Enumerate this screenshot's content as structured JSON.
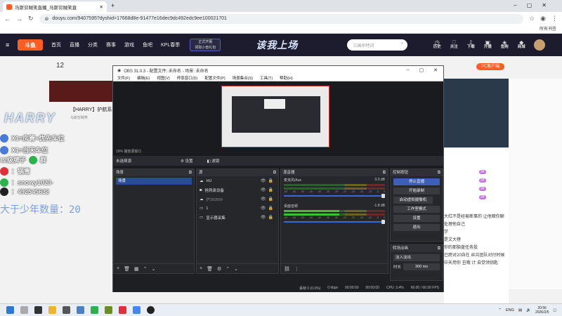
{
  "browser": {
    "tab_title": "马斯穷贼笑直播_马斯穷贼笑直",
    "url": "douyu.com/9407595?dyshid=17668d8e-91477e16dec9dc492edc9ee100021701",
    "bookmarks_label": "所有书签"
  },
  "douyu": {
    "logo": "斗鱼",
    "nav": [
      "首页",
      "直播",
      "分类",
      "赛事",
      "游戏",
      "鱼吧",
      "KPL春季"
    ],
    "promo_line1": "正式开服",
    "promo_line2": "领取小兽礼包",
    "banner": "该我上场",
    "search_placeholder": "三国杀特训",
    "header_icons": [
      "历史",
      "关注",
      "下载",
      "开播",
      "鱼购",
      "商城"
    ],
    "day_num": "12",
    "pc_badge": "PC客户端",
    "streamer_name": "【HARRY】护航系",
    "streamer_sub": "马斯穷贼笑"
  },
  "overlay": {
    "harry": "HARRY",
    "lines": [
      "X1=房管+优先车位",
      "X1=当天车位",
      "12级牌子",
      "：锅雪",
      "：snowy1023-",
      "：492545632"
    ],
    "group_word": "群",
    "counter": "大于少年数量：20"
  },
  "chat": {
    "lines": [
      "大红不是经易断事的 让他暗你聊",
      "处理他自己",
      "学",
      "是文大榜",
      "你的那脑盘任务投",
      "已跨对20自在 丝兵团队对付时候",
      "中天用你 丑哦 计 自觉领钥匙"
    ],
    "levels": [
      "34",
      "34",
      "34",
      "34"
    ]
  },
  "obs": {
    "title": "OBS 31.0.3 - 配置文件: 未命名 - 场景: 未命名",
    "menu": [
      "文件(F)",
      "编辑(E)",
      "视图(V)",
      "停靠窗口(D)",
      "配置文件(P)",
      "场景集合(S)",
      "工具(T)",
      "帮助(H)"
    ],
    "zoom": "19%   播放源窗口",
    "no_source": "未选择源",
    "settings_btn": "设置",
    "filters_btn": "滤镜",
    "scenes_title": "场景",
    "scene_items": [
      "场景"
    ],
    "sources_title": "源",
    "sources": [
      "HU",
      "抢两录设备",
      "护282BW",
      "1",
      "显示器采集"
    ],
    "mixer_title": "混音器",
    "mixer": [
      {
        "name": "麦克风/Aux",
        "db": "0.0 dB"
      },
      {
        "name": "桌面音频",
        "db": "-1.8 dB"
      }
    ],
    "mixer_scale": [
      "-60",
      "-55",
      "-50",
      "-45",
      "-40",
      "-35",
      "-30",
      "-25",
      "-20",
      "-15",
      "-10",
      "-5",
      "0"
    ],
    "controls_title": "控制按钮",
    "controls": [
      "停止直播",
      "开始录制",
      "启动虚拟摄像机",
      "工作室模式",
      "设置",
      "退出"
    ],
    "transition_title": "转场动画",
    "transition_value": "淡入淡出",
    "duration_label": "时长",
    "duration_value": "300 ms",
    "status": [
      "丢帧 0 (0.0%)",
      "0 kbps",
      "00:00:00",
      "00:00:00",
      "CPU: 3.4%",
      "60.00 / 60.00 FPS"
    ]
  },
  "taskbar": {
    "lang": "ENG",
    "time": "20:56",
    "date": "2026/2/5"
  }
}
